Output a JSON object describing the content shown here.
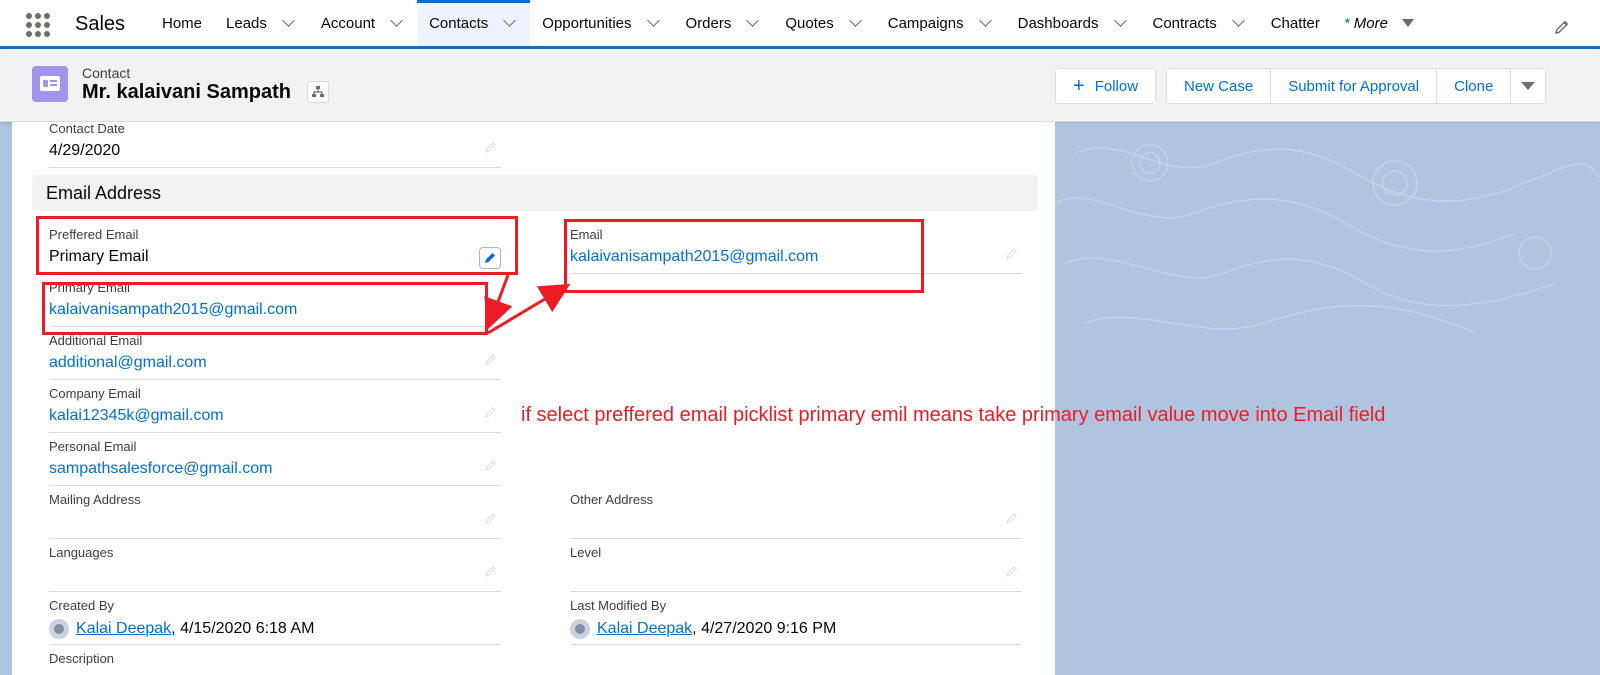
{
  "nav": {
    "app_name": "Sales",
    "items": [
      {
        "label": "Home",
        "chevron": false
      },
      {
        "label": "Leads",
        "chevron": true
      },
      {
        "label": "Account",
        "chevron": true
      },
      {
        "label": "Contacts",
        "chevron": true,
        "active": true
      },
      {
        "label": "Opportunities",
        "chevron": true
      },
      {
        "label": "Orders",
        "chevron": true
      },
      {
        "label": "Quotes",
        "chevron": true
      },
      {
        "label": "Campaigns",
        "chevron": true
      },
      {
        "label": "Dashboards",
        "chevron": true
      },
      {
        "label": "Contracts",
        "chevron": true
      },
      {
        "label": "Chatter",
        "chevron": false
      }
    ],
    "more_star": "*",
    "more_label": "More"
  },
  "record": {
    "type": "Contact",
    "title": "Mr. kalaivani Sampath",
    "actions": {
      "follow": "Follow",
      "new_case": "New Case",
      "submit": "Submit for Approval",
      "clone": "Clone"
    }
  },
  "fields": {
    "contact_date": {
      "label": "Contact Date",
      "value": "4/29/2020"
    },
    "section_email": "Email Address",
    "preferred_email": {
      "label": "Preffered Email",
      "value": "Primary Email"
    },
    "email": {
      "label": "Email",
      "value": "kalaivanisampath2015@gmail.com"
    },
    "primary_email": {
      "label": "Primary Email",
      "value": "kalaivanisampath2015@gmail.com"
    },
    "additional_email": {
      "label": "Additional Email",
      "value": "additional@gmail.com"
    },
    "company_email": {
      "label": "Company Email",
      "value": "kalai12345k@gmail.com"
    },
    "personal_email": {
      "label": "Personal Email",
      "value": "sampathsalesforce@gmail.com"
    },
    "mailing_address": {
      "label": "Mailing Address",
      "value": ""
    },
    "other_address": {
      "label": "Other Address",
      "value": ""
    },
    "languages": {
      "label": "Languages",
      "value": ""
    },
    "level": {
      "label": "Level",
      "value": ""
    },
    "created_by": {
      "label": "Created By",
      "user": "Kalai Deepak",
      "date": ", 4/15/2020 6:18 AM"
    },
    "last_modified_by": {
      "label": "Last Modified By",
      "user": "Kalai Deepak",
      "date": ", 4/27/2020 9:16 PM"
    },
    "description": {
      "label": "Description"
    }
  },
  "annotation": "if select preffered email picklist primary emil means take primary email value move into Email field",
  "colors": {
    "accent": "#0070d2",
    "annotation_red": "#ed1c24",
    "background": "#b0c4df"
  }
}
